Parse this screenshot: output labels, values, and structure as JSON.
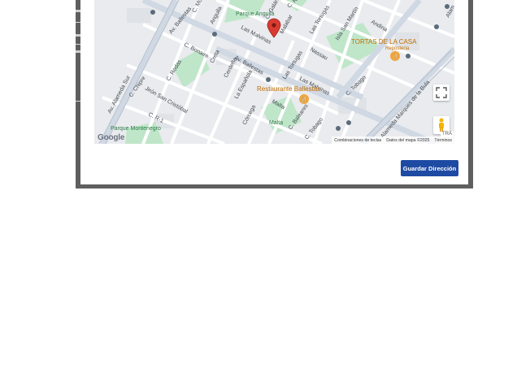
{
  "map": {
    "labels": {
      "parque_anguila": "Parque Anguila",
      "parque_montenegro": "Parque Montenegro",
      "malta": "Malta",
      "av_alameda_sur": "Av. Alameda Sur",
      "av_ballestas_1": "Av. Ballestas",
      "av_ballestas_2": "Av. Ballestas",
      "alameda_marques": "Alameda Marques de la Bula",
      "las_tortugas": "Las Tortugas",
      "las_tortugas_2": "Las Tortugas",
      "las_malvinas": "Las Malvinas",
      "las_malvinas_2": "Las Malvinas",
      "isla_san_martin": "Isla San Martín",
      "nassau": "Nassau",
      "andina": "Andina",
      "c_bonaire": "C. Bonaire",
      "c_rodas": "C. Rodas",
      "c_chipre": "C. Chipre",
      "jiron_san_cristobal": "Jirón San Cristóbal",
      "c_r1": "C. R-1",
      "c_tobago": "C. Tobago",
      "c_tobago_2": "C. Tobago",
      "c_baleares": "C. Baleares",
      "cerdena": "Cerdeña",
      "la_espanola": "La Española",
      "corcega": "Córcega",
      "anguila": "Anguila",
      "creta": "Creta",
      "malta_st": "Malta",
      "c_mo": "C. Mo",
      "c_galan": "C. Galán",
      "redonda": "C. Redonda",
      "malabar": "Malabar",
      "alam": "Alam"
    },
    "places": {
      "tortas": "TORTAS DE LA CASA",
      "tortas_sub": "Repostería",
      "restaurante": "Restaurante Ballestas"
    },
    "google_logo": "Google",
    "tra": "TRA",
    "attribution": {
      "shortcuts": "Combinaciones de teclas",
      "map_data": "Datos del mapa ©2025",
      "terms": "Términos"
    }
  },
  "actions": {
    "save_label": "Guardar Dirección"
  },
  "colors": {
    "primary_button": "#1d4aa3",
    "marker": "#d93b30",
    "poi_orange": "#f0a53b",
    "park_green": "#bfe6c9",
    "backdrop": "#5f5f5f"
  }
}
